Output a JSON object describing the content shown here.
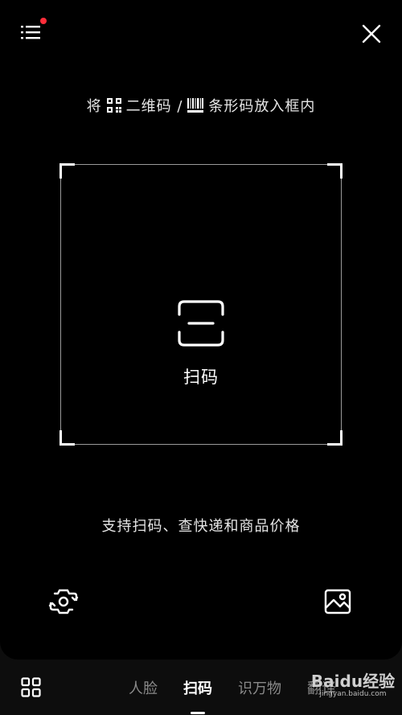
{
  "header": {
    "menu_icon": "list-menu-icon",
    "notification_color": "#ff2d3a",
    "close_icon": "close-icon"
  },
  "hint": {
    "prefix": "将",
    "qr_label": "二维码 /",
    "barcode_label": "条形码放入框内"
  },
  "scanner": {
    "label": "扫码"
  },
  "support_text": "支持扫码、查快递和商品价格",
  "actions": {
    "flip_icon": "camera-flip-icon",
    "album_icon": "image-album-icon"
  },
  "nav": {
    "tabs": [
      {
        "label": "人脸"
      },
      {
        "label": "扫码"
      },
      {
        "label": "识万物"
      },
      {
        "label": "翻译"
      }
    ],
    "active_index": 1
  },
  "watermark": {
    "brand": "Baidu经验",
    "url": "jingyan.baidu.com"
  }
}
